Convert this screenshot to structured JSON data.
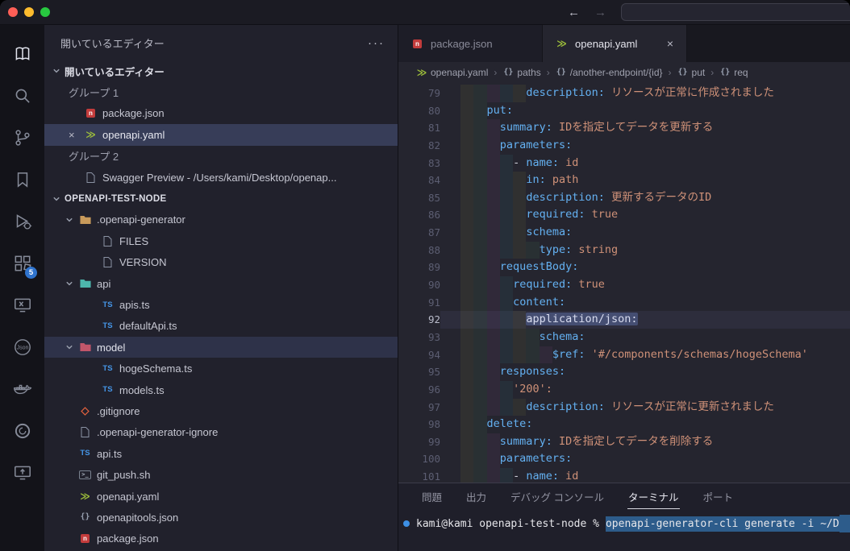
{
  "glyphs": {
    "close": "×",
    "more": "···",
    "crumb_sep": "›"
  },
  "colors": {
    "key_blue": "#64b1f2",
    "string_orange": "#cf9178",
    "terminal_selection": "#2d5c8b",
    "badge_blue": "#2f73cd",
    "npm_red": "#c33c3c",
    "openapi_green": "#9ebf3b",
    "ts_blue": "#4596e8",
    "git_orange": "#e0613e"
  },
  "titlebar": {
    "back": "←",
    "forward": "→",
    "search_value": ""
  },
  "activity_bar": {
    "items": [
      {
        "id": "reader",
        "active": true
      },
      {
        "id": "search"
      },
      {
        "id": "source-control"
      },
      {
        "id": "bookmarks"
      },
      {
        "id": "run-debug"
      },
      {
        "id": "extensions",
        "badge": "5"
      },
      {
        "id": "remote-monitor"
      },
      {
        "id": "json-viewer",
        "text": "Json"
      },
      {
        "id": "docker"
      },
      {
        "id": "circle-tool"
      },
      {
        "id": "screen-share"
      }
    ]
  },
  "sidebar": {
    "title": "開いているエディター",
    "open_editors": {
      "header": "開いているエディター",
      "groups": [
        {
          "id": "group-1",
          "label": "グループ 1",
          "items": [
            {
              "label": "package.json",
              "icon": "npm"
            },
            {
              "label": "openapi.yaml",
              "icon": "openapi",
              "selected": true,
              "close": true
            }
          ]
        },
        {
          "id": "group-2",
          "label": "グループ 2",
          "items": [
            {
              "label": "Swagger Preview - /Users/kami/Desktop/openap...",
              "icon": "file"
            }
          ]
        }
      ]
    },
    "explorer": {
      "header": "OPENAPI-TEST-NODE",
      "items": [
        {
          "label": ".openapi-generator",
          "icon": "folder",
          "color": "#c89a5b",
          "depth": 0,
          "chevron": true
        },
        {
          "label": "FILES",
          "icon": "file",
          "depth": 1
        },
        {
          "label": "VERSION",
          "icon": "file",
          "depth": 1
        },
        {
          "label": "api",
          "icon": "folder",
          "color": "#4db6ac",
          "depth": 0,
          "chevron": true
        },
        {
          "label": "apis.ts",
          "icon": "ts",
          "depth": 1
        },
        {
          "label": "defaultApi.ts",
          "icon": "ts",
          "depth": 1
        },
        {
          "label": "model",
          "icon": "folder",
          "color": "#c2566a",
          "depth": 0,
          "chevron": true,
          "selected": true
        },
        {
          "label": "hogeSchema.ts",
          "icon": "ts",
          "depth": 1
        },
        {
          "label": "models.ts",
          "icon": "ts",
          "depth": 1
        },
        {
          "label": ".gitignore",
          "icon": "git",
          "depth": 0
        },
        {
          "label": ".openapi-generator-ignore",
          "icon": "file",
          "depth": 0
        },
        {
          "label": "api.ts",
          "icon": "ts",
          "depth": 0
        },
        {
          "label": "git_push.sh",
          "icon": "shell",
          "depth": 0
        },
        {
          "label": "openapi.yaml",
          "icon": "openapi",
          "depth": 0
        },
        {
          "label": "openapitools.json",
          "icon": "braces",
          "depth": 0
        },
        {
          "label": "package.json",
          "icon": "npm",
          "depth": 0
        }
      ]
    }
  },
  "editor": {
    "tabs": [
      {
        "label": "package.json",
        "icon": "npm",
        "active": false
      },
      {
        "label": "openapi.yaml",
        "icon": "openapi",
        "active": true
      }
    ],
    "breadcrumb": [
      {
        "label": "openapi.yaml",
        "icon": "openapi"
      },
      {
        "label": "paths",
        "icon": "braces"
      },
      {
        "label": "/another-endpoint/{id}",
        "icon": "braces"
      },
      {
        "label": "put",
        "icon": "braces"
      },
      {
        "label": "req",
        "icon": "braces"
      }
    ],
    "code_lines": [
      {
        "n": 79,
        "i": 10,
        "t": [
          [
            "k",
            "description:"
          ],
          [
            "v",
            " リソースが正常に作成されました"
          ]
        ]
      },
      {
        "n": 80,
        "i": 4,
        "t": [
          [
            "k",
            "put:"
          ]
        ]
      },
      {
        "n": 81,
        "i": 6,
        "t": [
          [
            "k",
            "summary:"
          ],
          [
            "v",
            " IDを指定してデータを更新する"
          ]
        ]
      },
      {
        "n": 82,
        "i": 6,
        "t": [
          [
            "k",
            "parameters:"
          ]
        ]
      },
      {
        "n": 83,
        "i": 8,
        "t": [
          [
            "p",
            "- "
          ],
          [
            "k",
            "name:"
          ],
          [
            "v",
            " id"
          ]
        ]
      },
      {
        "n": 84,
        "i": 10,
        "t": [
          [
            "k",
            "in:"
          ],
          [
            "v",
            " path"
          ]
        ]
      },
      {
        "n": 85,
        "i": 10,
        "t": [
          [
            "k",
            "description:"
          ],
          [
            "v",
            " 更新するデータのID"
          ]
        ]
      },
      {
        "n": 86,
        "i": 10,
        "t": [
          [
            "k",
            "required:"
          ],
          [
            "v",
            " true"
          ]
        ]
      },
      {
        "n": 87,
        "i": 10,
        "t": [
          [
            "k",
            "schema:"
          ]
        ]
      },
      {
        "n": 88,
        "i": 12,
        "t": [
          [
            "k",
            "type:"
          ],
          [
            "v",
            " string"
          ]
        ]
      },
      {
        "n": 89,
        "i": 6,
        "t": [
          [
            "k",
            "requestBody:"
          ]
        ]
      },
      {
        "n": 90,
        "i": 8,
        "t": [
          [
            "k",
            "required:"
          ],
          [
            "v",
            " true"
          ]
        ]
      },
      {
        "n": 91,
        "i": 8,
        "t": [
          [
            "k",
            "content:"
          ]
        ]
      },
      {
        "n": 92,
        "i": 10,
        "cur": true,
        "t": [
          [
            "o",
            "application/json:"
          ]
        ]
      },
      {
        "n": 93,
        "i": 12,
        "t": [
          [
            "k",
            "schema:"
          ]
        ]
      },
      {
        "n": 94,
        "i": 14,
        "t": [
          [
            "k",
            "$ref:"
          ],
          [
            "v",
            " '#/components/schemas/hogeSchema'"
          ]
        ]
      },
      {
        "n": 95,
        "i": 6,
        "t": [
          [
            "k",
            "responses:"
          ]
        ]
      },
      {
        "n": 96,
        "i": 8,
        "t": [
          [
            "v",
            "'200':"
          ]
        ]
      },
      {
        "n": 97,
        "i": 10,
        "t": [
          [
            "k",
            "description:"
          ],
          [
            "v",
            " リソースが正常に更新されました"
          ]
        ]
      },
      {
        "n": 98,
        "i": 4,
        "t": [
          [
            "k",
            "delete:"
          ]
        ]
      },
      {
        "n": 99,
        "i": 6,
        "t": [
          [
            "k",
            "summary:"
          ],
          [
            "v",
            " IDを指定してデータを削除する"
          ]
        ]
      },
      {
        "n": 100,
        "i": 6,
        "t": [
          [
            "k",
            "parameters:"
          ]
        ]
      },
      {
        "n": 101,
        "i": 8,
        "t": [
          [
            "p",
            "- "
          ],
          [
            "k",
            "name:"
          ],
          [
            "v",
            " id"
          ]
        ]
      }
    ]
  },
  "panel": {
    "tabs": [
      {
        "id": "problems",
        "label": "問題"
      },
      {
        "id": "output",
        "label": "出力"
      },
      {
        "id": "debug-console",
        "label": "デバッグ コンソール"
      },
      {
        "id": "terminal",
        "label": "ターミナル",
        "active": true
      },
      {
        "id": "ports",
        "label": "ポート"
      }
    ],
    "terminal": {
      "marker_color": "#3d8fe4",
      "prompt": "kami@kami openapi-test-node %",
      "command": "openapi-generator-cli generate -i ~/D"
    }
  }
}
